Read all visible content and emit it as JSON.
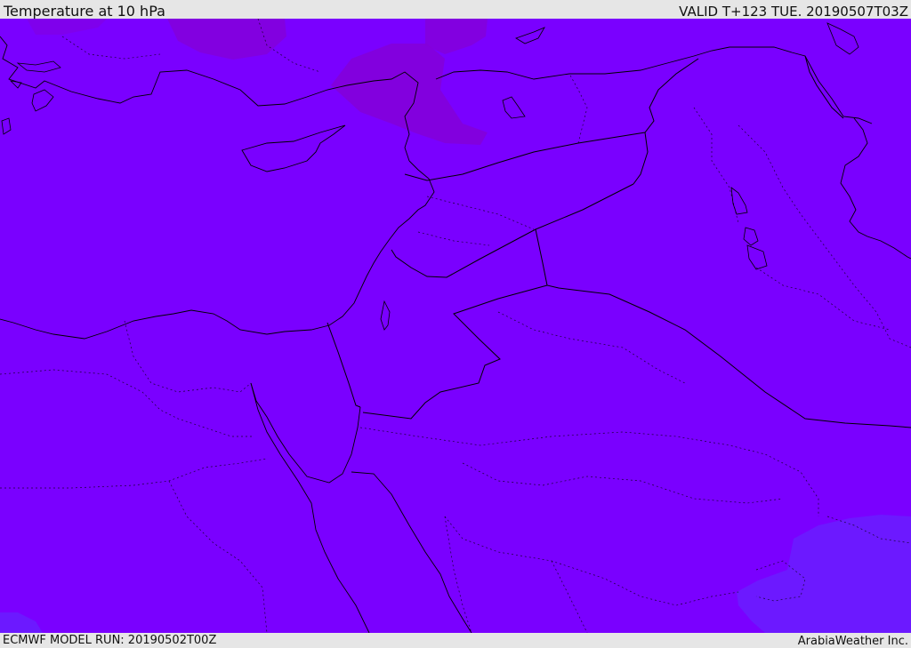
{
  "header": {
    "title": "Temperature at 10 hPa",
    "valid_time": "VALID T+123 TUE. 20190507T03Z"
  },
  "footer": {
    "model_run": "ECMWF MODEL RUN: 20190502T00Z",
    "credit": "ArabiaWeather Inc."
  },
  "map": {
    "field_color": "#7a00ff",
    "warm_patch_color": "#8a00d8",
    "cool_patch_color": "#6a1cff",
    "coastline_color": "#000000",
    "border_color": "#000000"
  }
}
